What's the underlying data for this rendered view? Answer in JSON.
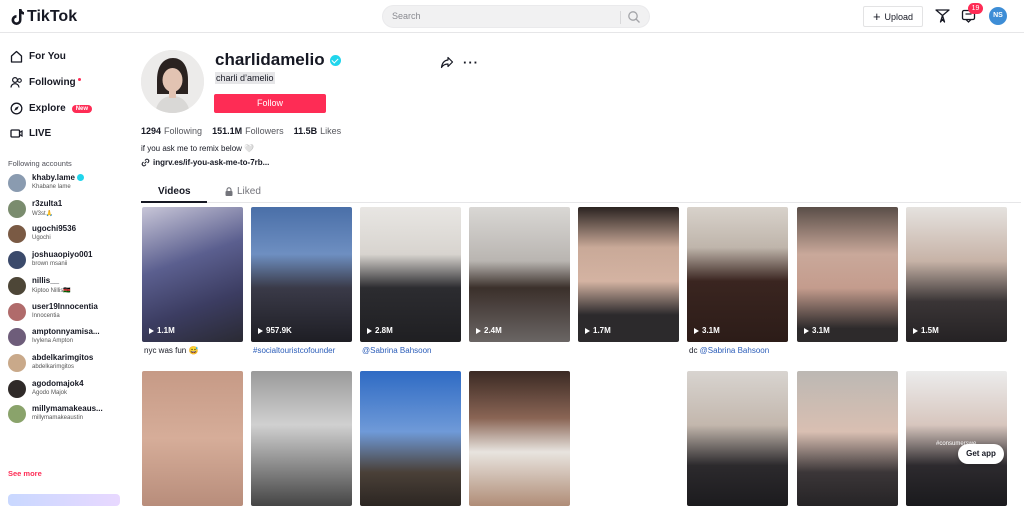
{
  "header": {
    "logo_text": "TikTok",
    "search_placeholder": "Search",
    "upload_label": "Upload",
    "inbox_badge": "19",
    "avatar_initials": "NS"
  },
  "sidebar": {
    "nav": [
      {
        "label": "For You",
        "icon": "home-icon"
      },
      {
        "label": "Following",
        "icon": "users-icon"
      },
      {
        "label": "Explore",
        "icon": "compass-icon",
        "badge": "New"
      },
      {
        "label": "LIVE",
        "icon": "live-icon"
      }
    ],
    "following_title": "Following accounts",
    "accounts": [
      {
        "username": "khaby.lame",
        "name": "Khabane lame",
        "verified": true,
        "color": "#8a9bb0"
      },
      {
        "username": "r3zulta1",
        "name": "W3st🙏",
        "color": "#7a8c6e"
      },
      {
        "username": "ugochi9536",
        "name": "Ugochi",
        "color": "#7a5a44"
      },
      {
        "username": "joshuaopiyo001",
        "name": "brown msanii",
        "color": "#3b4a6b"
      },
      {
        "username": "nillis__",
        "name": "Kiptoo Nillis🇰🇪",
        "color": "#4d4637"
      },
      {
        "username": "user19Innocentia",
        "name": "Innocentia",
        "color": "#b06b6b"
      },
      {
        "username": "amptonnyamisa...",
        "name": "Ivylena Ampton",
        "color": "#6e5d7a"
      },
      {
        "username": "abdelkarimgitos",
        "name": "abdelkarimgitos",
        "color": "#c9a98a"
      },
      {
        "username": "agodomajok4",
        "name": "Agodo Majok",
        "color": "#2f2a28"
      },
      {
        "username": "millymamakeaus...",
        "name": "millymamakeaustin",
        "color": "#8aa36b"
      }
    ],
    "see_more": "See more"
  },
  "profile": {
    "username": "charlidamelio",
    "display_name": "charli d’amelio",
    "follow_label": "Follow",
    "following_count": "1294",
    "following_label": "Following",
    "followers_count": "151.1M",
    "followers_label": "Followers",
    "likes_count": "11.5B",
    "likes_label": "Likes",
    "bio": "if you ask me to remix below 🤍",
    "link": "ingrv.es/if-you-ask-me-to-7rb..."
  },
  "tabs": {
    "videos": "Videos",
    "liked": "Liked"
  },
  "videos": [
    {
      "views": "1.1M",
      "caption": "nyc was fun 😅",
      "hashtag": "",
      "bg": "linear-gradient(160deg,#c8c6d8 0%,#5b5f8f 40%,#3c3d62 70%,#2a2a33 100%)"
    },
    {
      "views": "957.9K",
      "caption": "",
      "hashtag": "#socialtouristcofounder",
      "bg": "linear-gradient(180deg,#4a6fa8 0%,#6e8fc1 35%,#3a3a48 60%,#1e1e24 100%)"
    },
    {
      "views": "2.8M",
      "caption": "",
      "hashtag": "@Sabrina Bahsoon",
      "bg": "linear-gradient(180deg,#e8e6e3 0%,#d8d4cf 35%,#2c2c30 60%,#1f1f22 100%)"
    },
    {
      "views": "2.4M",
      "caption": "",
      "hashtag": "",
      "bg": "linear-gradient(180deg,#d9d7d4 0%,#b9b5b1 40%,#3b302b 60%,#6a6564 100%)"
    },
    {
      "views": "1.7M",
      "caption": "",
      "hashtag": "",
      "bg": "linear-gradient(180deg,#2a2321 0%,#c9a998 30%,#d4b3a2 55%,#2c2a2c 80%)"
    },
    {
      "views": "3.1M",
      "caption": "dc ",
      "hashtag": "@Sabrina Bahsoon",
      "bg": "linear-gradient(180deg,#d8d2cb 0%,#bfb5ab 30%,#3a2520 55%,#2c1c18 100%)"
    },
    {
      "views": "3.1M",
      "caption": "",
      "hashtag": "",
      "bg": "linear-gradient(180deg,#5a4e48 0%,#c9a89a 35%,#c49c8d 60%,#2d2a2b 90%)"
    },
    {
      "views": "1.5M",
      "caption": "",
      "hashtag": "",
      "bg": "linear-gradient(180deg,#e5e2df 0%,#c7b3a7 40%,#3a3536 70%,#252224 100%)"
    },
    {
      "views": "",
      "caption": "",
      "hashtag": "",
      "bg": "linear-gradient(180deg,#c69a86 0%,#d6ad99 50%,#b88d7b 100%)"
    },
    {
      "views": "",
      "caption": "",
      "hashtag": "",
      "bg": "linear-gradient(180deg,#9a9a9a 0%,#d0d0d0 40%,#454545 100%)"
    },
    {
      "views": "",
      "caption": "",
      "hashtag": "",
      "bg": "linear-gradient(180deg,#2f6bc4 0%,#6f9ad8 45%,#4a4038 75%,#2c2622 100%)"
    },
    {
      "views": "",
      "caption": "",
      "hashtag": "",
      "bg": "linear-gradient(180deg,#3b2a24 0%,#8a6555 35%,#e8e4df 60%,#b08d77 100%)"
    },
    {
      "views": "",
      "caption": "",
      "hashtag": "",
      "bg": "#ffffff"
    },
    {
      "views": "",
      "caption": "",
      "hashtag": "",
      "bg": "linear-gradient(180deg,#d8d4d0 0%,#c3b7ad 40%,#2c2a2d 70%,#1c1b1e 100%)"
    },
    {
      "views": "",
      "caption": "",
      "hashtag": "",
      "bg": "linear-gradient(180deg,#bcb8b3 0%,#d9bfb2 45%,#3b3638 75%,#262426 100%)"
    },
    {
      "views": "",
      "caption": "",
      "hashtag": "",
      "bg": "linear-gradient(180deg,#ececec 0%,#d7c6be 40%,#2d2a2e 70%,#1a1a1d 100%)"
    }
  ],
  "overlay_text": "#consumerswe",
  "get_app_label": "Get app",
  "colors": {
    "brand": "#fe2c55",
    "verified": "#20d5ec",
    "link": "#2b5db9"
  }
}
